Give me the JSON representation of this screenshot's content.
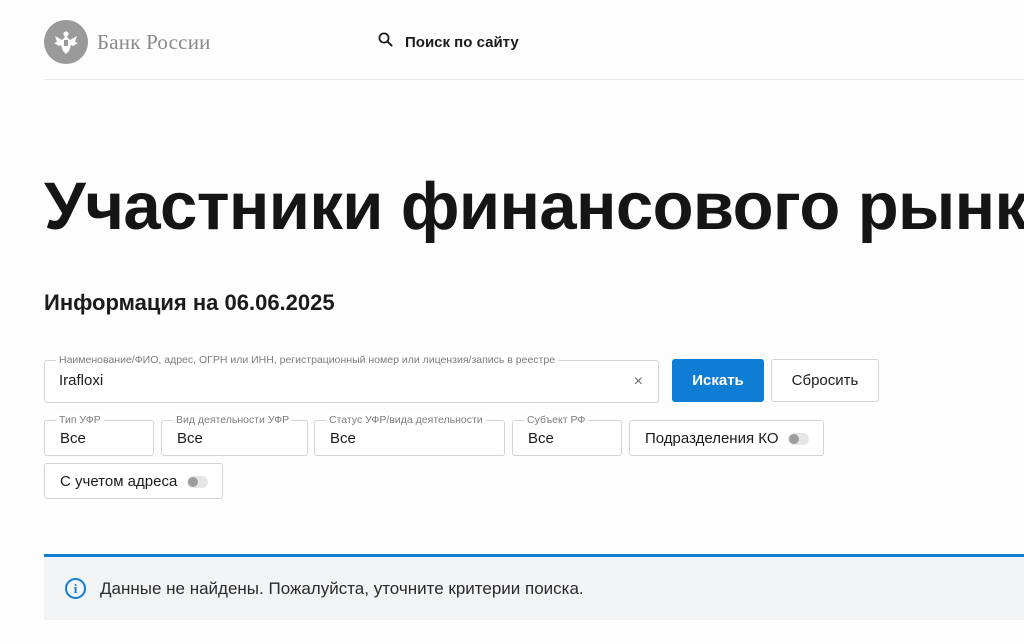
{
  "header": {
    "brand": "Банк России",
    "emblem_icon": "double-headed-eagle-emblem",
    "site_search_label": "Поиск по сайту",
    "site_search_icon": "search-icon"
  },
  "page": {
    "title": "Участники финансового рынка",
    "info_date": "Информация на 06.06.2025"
  },
  "search": {
    "label": "Наименование/ФИО, адрес, ОГРН или ИНН, регистрационный номер или лицензия/запись в реестре",
    "value": "Irafloxi",
    "clear_glyph": "×",
    "submit_label": "Искать",
    "reset_label": "Сбросить"
  },
  "filters": [
    {
      "label": "Тип УФР",
      "value": "Все"
    },
    {
      "label": "Вид деятельности УФР",
      "value": "Все"
    },
    {
      "label": "Статус УФР/вида деятельности",
      "value": "Все"
    },
    {
      "label": "Субъект РФ",
      "value": "Все"
    }
  ],
  "toggles": [
    {
      "label": "Подразделения КО",
      "on": false
    },
    {
      "label": "С учетом адреса",
      "on": false
    }
  ],
  "notice": {
    "icon": "info-icon",
    "text": "Данные не найдены. Пожалуйста, уточните критерии поиска."
  },
  "colors": {
    "accent": "#0f7dd3",
    "notice_bg": "#f2f3f5",
    "logo_gray": "#9a9a9a"
  }
}
